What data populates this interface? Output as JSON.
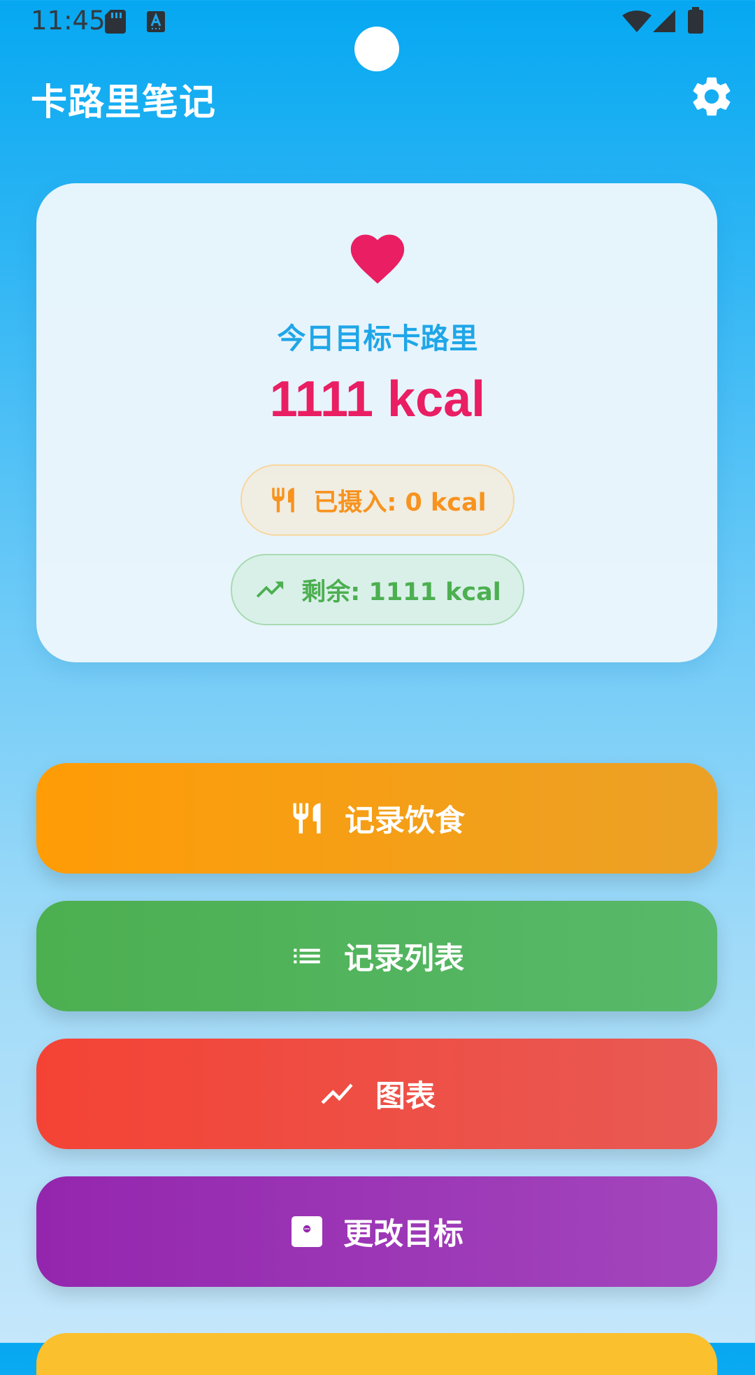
{
  "status_bar": {
    "time": "11:45",
    "icons": [
      "sd-card-icon",
      "keyboard-a-icon",
      "wifi-icon",
      "signal-icon",
      "battery-icon"
    ]
  },
  "app_bar": {
    "title": "卡路里笔记",
    "settings_icon": "gear-icon"
  },
  "goal_card": {
    "icon": "heart-icon",
    "label": "今日目标卡路里",
    "value": "1111 kcal",
    "intake": {
      "icon": "utensils-icon",
      "text": "已摄入: 0 kcal"
    },
    "remaining": {
      "icon": "trending-up-icon",
      "text": "剩余: 1111 kcal"
    }
  },
  "actions": [
    {
      "label": "记录饮食",
      "icon": "utensils-icon",
      "color": "#ff9c06"
    },
    {
      "label": "记录列表",
      "icon": "list-icon",
      "color": "#4caf50"
    },
    {
      "label": "图表",
      "icon": "chart-line-icon",
      "color": "#f44335"
    },
    {
      "label": "更改目标",
      "icon": "flag-card-icon",
      "color": "#9426ae"
    }
  ],
  "colors": {
    "header_blue": "#06a8f1",
    "goal_value": "#e91e63",
    "goal_label": "#1fa6e8",
    "intake": "#f7931e",
    "remaining": "#4caf50",
    "partial_button": "#fbc02d"
  }
}
